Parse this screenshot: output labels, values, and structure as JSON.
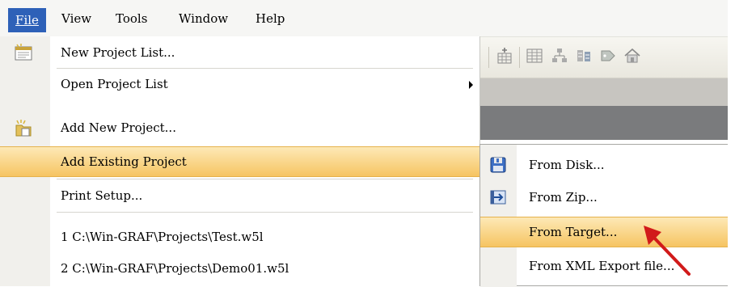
{
  "menubar": {
    "items": [
      {
        "label": "File"
      },
      {
        "label": "View"
      },
      {
        "label": "Tools"
      },
      {
        "label": "Window"
      },
      {
        "label": "Help"
      }
    ]
  },
  "file_menu": {
    "items": [
      {
        "label": "New Project List...",
        "icon": "new-project-list-icon"
      },
      {
        "label": "Open Project List",
        "has_submenu": true
      },
      {
        "label": "Add New Project...",
        "icon": "add-new-project-icon"
      },
      {
        "label": "Add Existing Project",
        "has_submenu": true,
        "highlighted": true
      },
      {
        "label": "Print Setup..."
      },
      {
        "label": "1 C:\\Win-GRAF\\Projects\\Test.w5l"
      },
      {
        "label": "2 C:\\Win-GRAF\\Projects\\Demo01.w5l"
      }
    ]
  },
  "submenu": {
    "items": [
      {
        "label": "From Disk...",
        "icon": "from-disk-icon"
      },
      {
        "label": "From Zip...",
        "icon": "from-zip-icon"
      },
      {
        "label": "From Target...",
        "highlighted": true
      },
      {
        "label": "From XML Export file..."
      }
    ]
  },
  "colors": {
    "menubar_active": "#2e61b8",
    "highlight_top": "#fde9b6",
    "highlight_bottom": "#f6c462",
    "callout_arrow": "#d11a1a"
  }
}
